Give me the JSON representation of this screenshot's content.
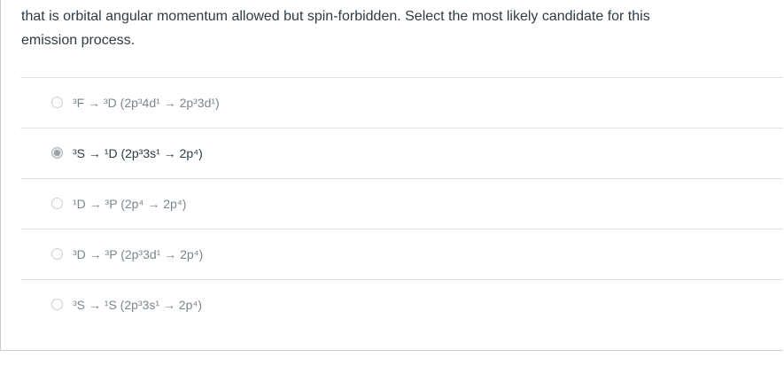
{
  "question": {
    "text_line_1": "that is orbital angular momentum allowed but spin-forbidden. Select the most likely candidate for this",
    "text_line_2": "emission process."
  },
  "answers": [
    {
      "label": "³F → ³D (2p³4d¹ → 2p³3d¹)",
      "selected": false
    },
    {
      "label": "³S → ¹D (2p³3s¹ → 2p⁴)",
      "selected": true
    },
    {
      "label": "¹D → ³P (2p⁴ → 2p⁴)",
      "selected": false
    },
    {
      "label": "³D → ³P (2p³3d¹ → 2p⁴)",
      "selected": false
    },
    {
      "label": "³S → ¹S (2p³3s¹ → 2p⁴)",
      "selected": false
    }
  ]
}
